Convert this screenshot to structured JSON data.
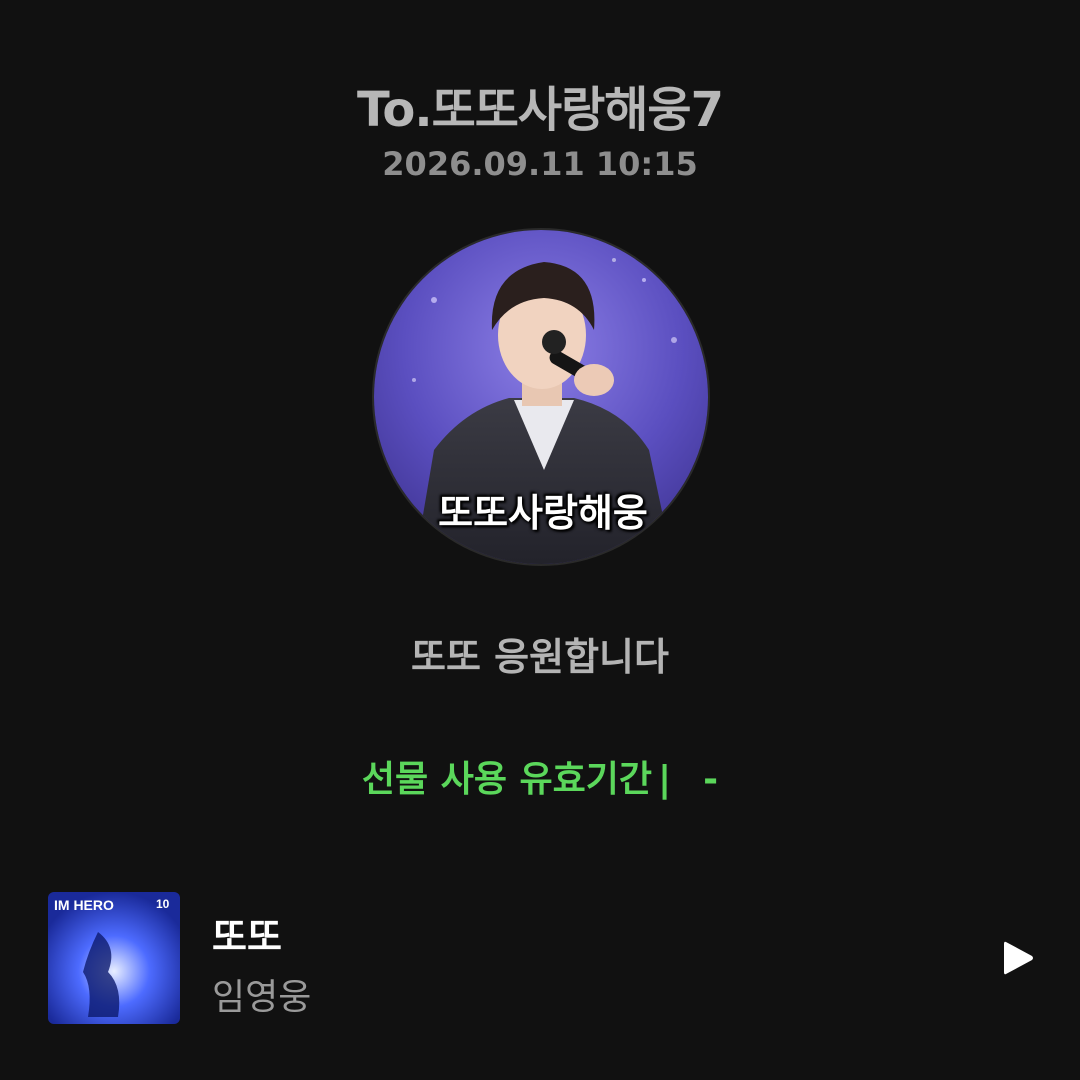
{
  "header": {
    "title": "To.또또사랑해웅7",
    "timestamp": "2026.09.11 10:15"
  },
  "profile": {
    "caption": "또또사랑해웅"
  },
  "message": {
    "text": "또또 응원합니다"
  },
  "gift": {
    "label": "선물 사용 유효기간",
    "separator": "|",
    "value": "-",
    "color": "#5bd75b"
  },
  "music": {
    "title": "또또",
    "artist": "임영웅",
    "album_art_text": "IM HERO",
    "icon": "play-icon"
  }
}
